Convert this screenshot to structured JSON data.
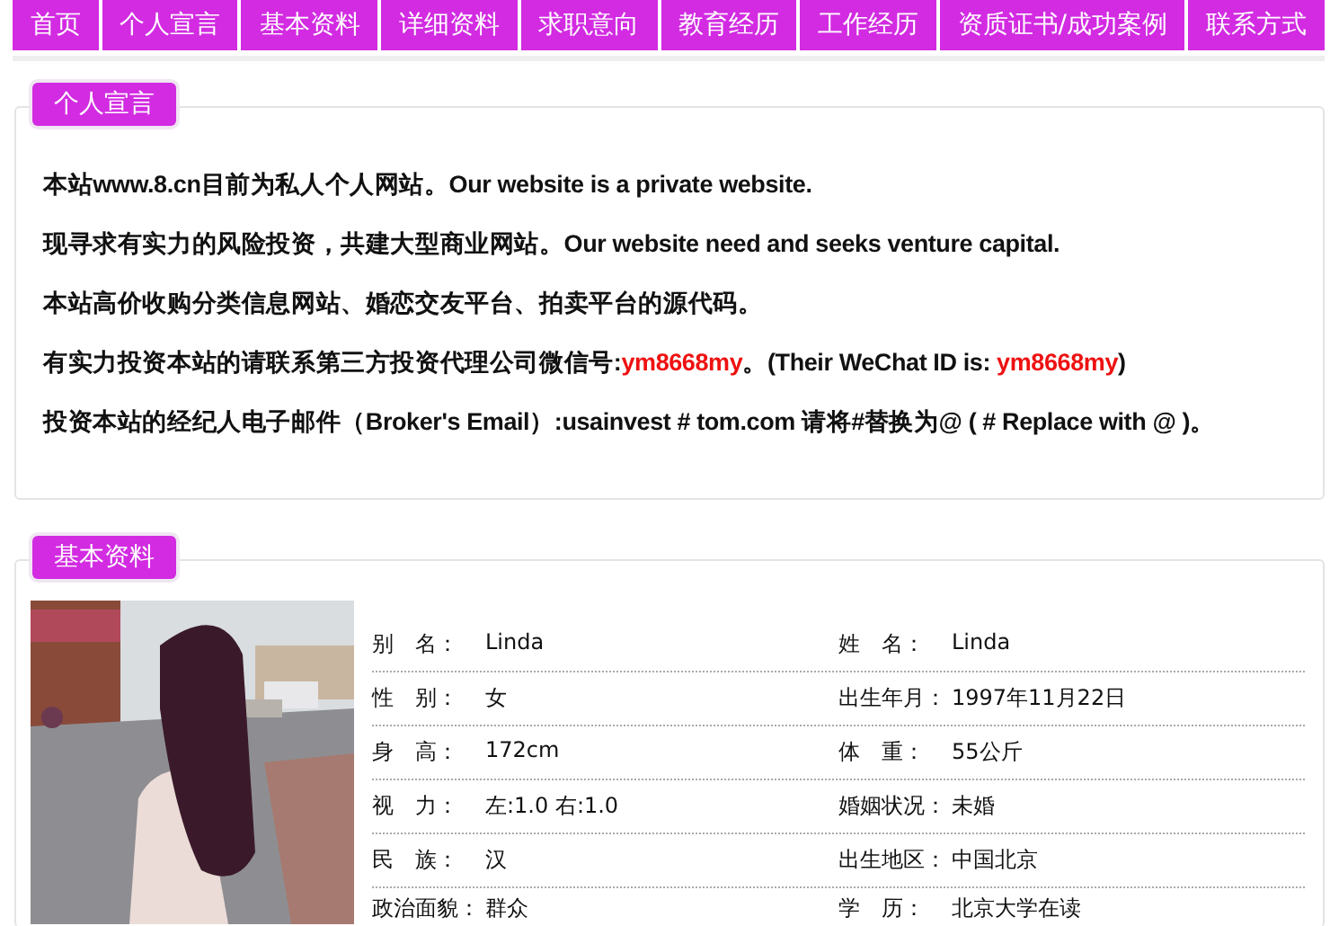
{
  "nav": [
    {
      "label": "首页"
    },
    {
      "label": "个人宣言"
    },
    {
      "label": "基本资料"
    },
    {
      "label": "详细资料"
    },
    {
      "label": "求职意向"
    },
    {
      "label": "教育经历"
    },
    {
      "label": "工作经历"
    },
    {
      "label": "资质证书/成功案例"
    },
    {
      "label": "联系方式"
    }
  ],
  "declaration": {
    "title": "个人宣言",
    "lines": [
      [
        {
          "text": "本站www.8.cn目前为私人个人网站。Our website is a private website.",
          "highlight": false
        }
      ],
      [
        {
          "text": "现寻求有实力的风险投资，共建大型商业网站。Our website need and seeks venture capital.",
          "highlight": false
        }
      ],
      [
        {
          "text": "本站高价收购分类信息网站、婚恋交友平台、拍卖平台的源代码。",
          "highlight": false
        }
      ],
      [
        {
          "text": "有实力投资本站的请联系第三方投资代理公司微信号:",
          "highlight": false
        },
        {
          "text": "ym8668my",
          "highlight": true
        },
        {
          "text": "。(Their WeChat ID is: ",
          "highlight": false
        },
        {
          "text": "ym8668my",
          "highlight": true
        },
        {
          "text": ")",
          "highlight": false
        }
      ],
      [
        {
          "text": "投资本站的经纪人电子邮件（Broker's Email）:usainvest # tom.com 请将#替换为@ ( # Replace with @ )。",
          "highlight": false
        }
      ]
    ]
  },
  "basic": {
    "title": "基本资料",
    "fields": [
      {
        "label": "别　名：",
        "value": "Linda"
      },
      {
        "label": "姓　名：",
        "value": "Linda"
      },
      {
        "label": "性　别：",
        "value": "女"
      },
      {
        "label": "出生年月：",
        "value": "1997年11月22日"
      },
      {
        "label": "身　高：",
        "value": "172cm"
      },
      {
        "label": "体　重：",
        "value": "55公斤"
      },
      {
        "label": "视　力：",
        "value": "左:1.0 右:1.0"
      },
      {
        "label": "婚姻状况：",
        "value": "未婚"
      },
      {
        "label": "民　族：",
        "value": "汉"
      },
      {
        "label": "出生地区：",
        "value": "中国北京"
      },
      {
        "label": "政治面貌：",
        "value": "群众"
      },
      {
        "label": "学　历：",
        "value": "北京大学在读"
      }
    ]
  }
}
